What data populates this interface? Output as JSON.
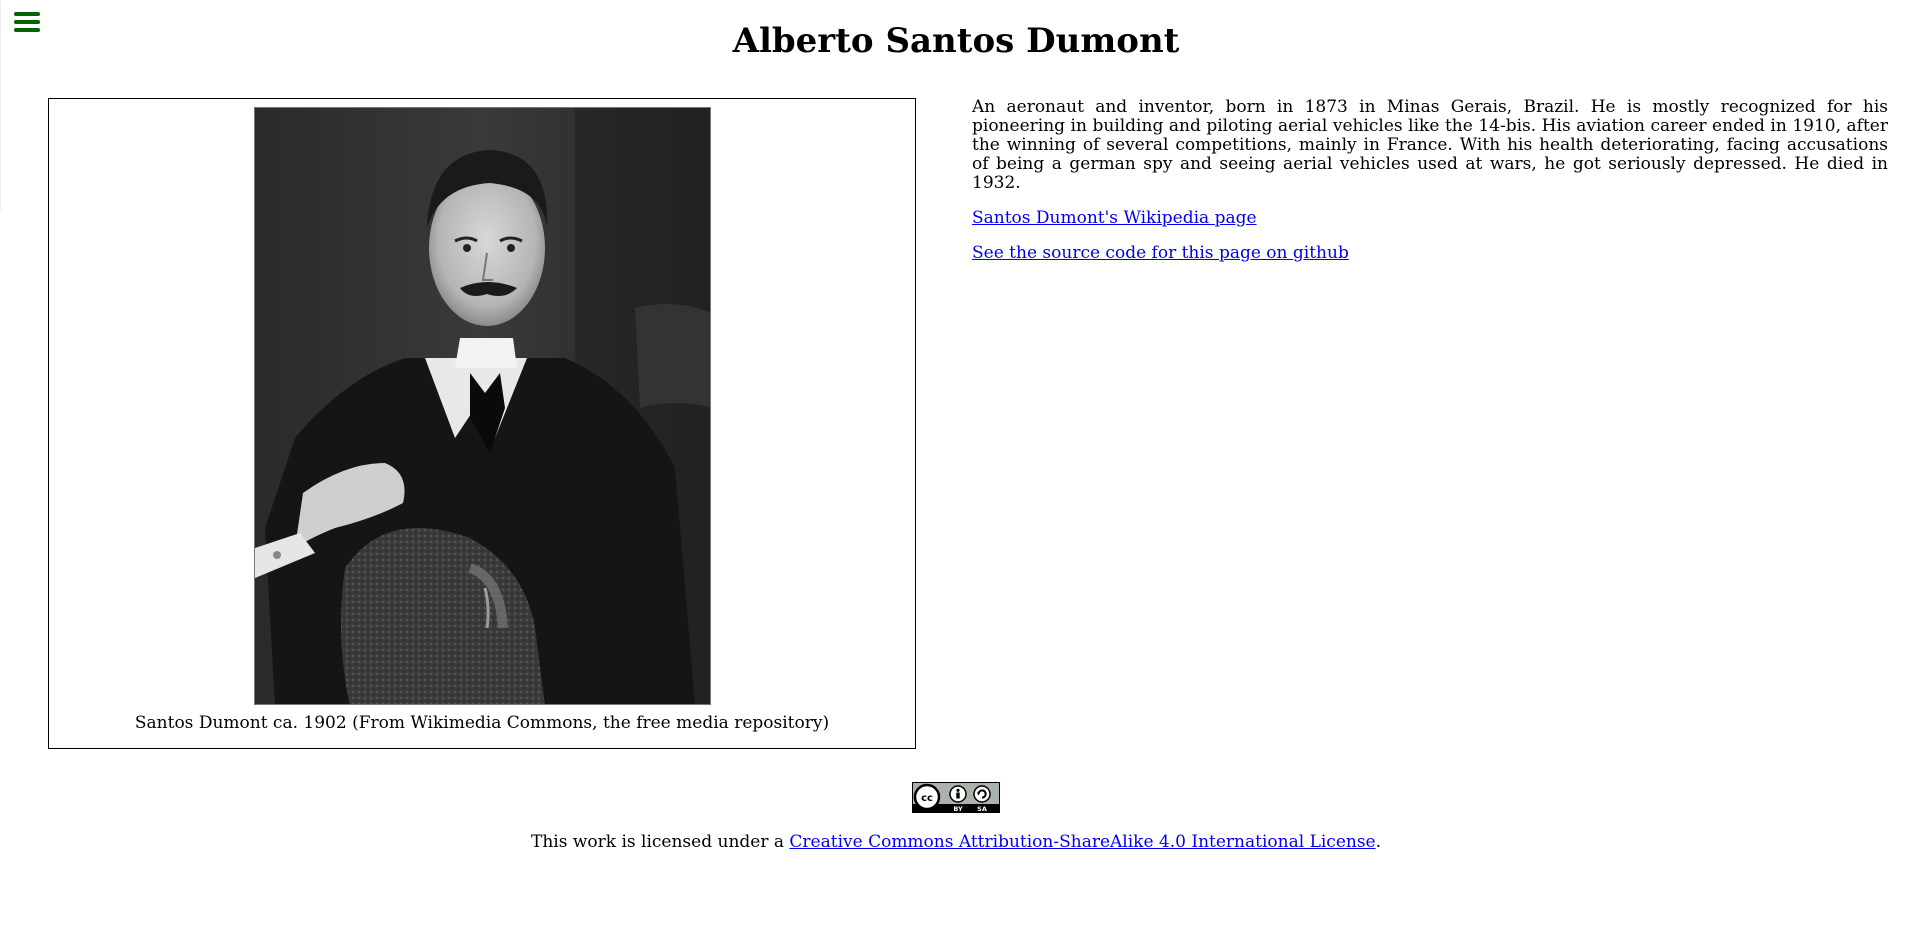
{
  "page": {
    "title": "Alberto Santos Dumont"
  },
  "menu": {
    "icon": "hamburger-menu-icon",
    "color": "#006400"
  },
  "figure": {
    "image_alt": "Santos Dumont ca. 1902",
    "caption": "Santos Dumont ca. 1902 (From Wikimedia Commons, the free media repository)"
  },
  "bio": {
    "text": "An aeronaut and inventor, born in 1873 in Minas Gerais, Brazil. He is mostly recognized for his pioneering in building and piloting aerial vehicles like the 14-bis. His aviation career ended in 1910, after the winning of several competitions, mainly in France. With his health deteriorating, facing accusations of being a german spy and seeing aerial vehicles used at wars, he got seriously depressed. He died in 1932."
  },
  "links": {
    "wikipedia": "Santos Dumont's Wikipedia page",
    "github": "See the source code for this page on github"
  },
  "footer": {
    "badge_icon": "creative-commons-by-sa-badge",
    "badge_by": "BY",
    "badge_sa": "SA",
    "license_prefix": "This work is licensed under a ",
    "license_link": "Creative Commons Attribution-ShareAlike 4.0 International License",
    "license_suffix": "."
  },
  "colors": {
    "link": "#0000ee",
    "menu_icon": "#006400"
  }
}
